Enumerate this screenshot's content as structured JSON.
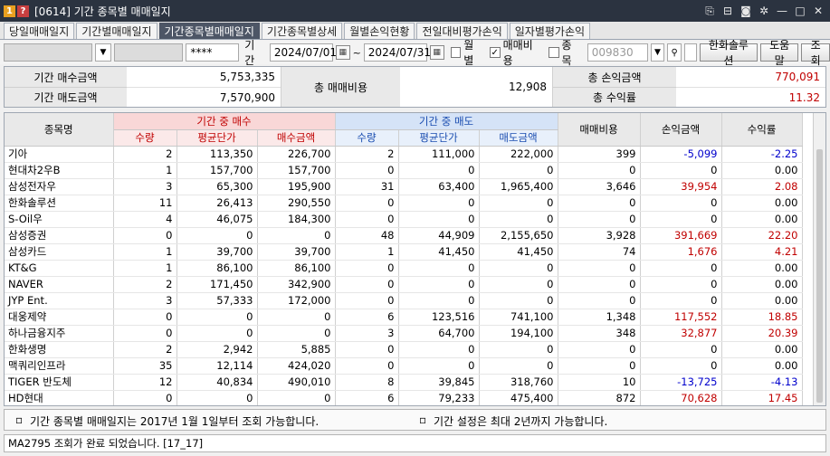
{
  "window": {
    "badge_num": "1",
    "badge_help": "?",
    "title": "[0614] 기간 종목별 매매일지",
    "icons": [
      "link-icon",
      "pin-icon",
      "camera-icon",
      "gear-icon",
      "minimize-icon",
      "maximize-icon",
      "close-icon"
    ]
  },
  "tabs": [
    {
      "label": "당일매매일지",
      "active": false
    },
    {
      "label": "기간별매매일지",
      "active": false
    },
    {
      "label": "기간종목별매매일지",
      "active": true
    },
    {
      "label": "기간종목별상세",
      "active": false
    },
    {
      "label": "월별손익현황",
      "active": false
    },
    {
      "label": "전일대비평가손익",
      "active": false
    },
    {
      "label": "일자별평가손익",
      "active": false
    }
  ],
  "filter": {
    "password": "****",
    "period_label": "기간",
    "start_date": "2024/07/01",
    "tilde": "~",
    "end_date": "2024/07/31",
    "monthly_label": "월별",
    "fee_label": "매매비용",
    "item_label": "종 목",
    "item_placeholder": "009830",
    "company_button": "한화솔루션",
    "help_button": "도움말",
    "query_button": "조회"
  },
  "summary": {
    "buy_amount_label": "기간 매수금액",
    "buy_amount": "5,753,335",
    "sell_amount_label": "기간 매도금액",
    "sell_amount": "7,570,900",
    "total_fee_label": "총 매매비용",
    "total_fee": "12,908",
    "total_pl_label": "총 손익금액",
    "total_pl": "770,091",
    "total_rate_label": "총 수익률",
    "total_rate": "11.32"
  },
  "grid": {
    "headers": {
      "name": "종목명",
      "buy_group": "기간 중 매수",
      "sell_group": "기간 중 매도",
      "fee": "매매비용",
      "pl": "손익금액",
      "rate": "수익률",
      "qty": "수량",
      "avg": "평균단가",
      "buy_amt": "매수금액",
      "sell_amt": "매도금액"
    },
    "rows": [
      [
        "기아",
        "2",
        "113,350",
        "226,700",
        "2",
        "111,000",
        "222,000",
        "399",
        "-5,099",
        "-2.25"
      ],
      [
        "현대차2우B",
        "1",
        "157,700",
        "157,700",
        "0",
        "0",
        "0",
        "0",
        "0",
        "0.00"
      ],
      [
        "삼성전자우",
        "3",
        "65,300",
        "195,900",
        "31",
        "63,400",
        "1,965,400",
        "3,646",
        "39,954",
        "2.08"
      ],
      [
        "한화솔루션",
        "11",
        "26,413",
        "290,550",
        "0",
        "0",
        "0",
        "0",
        "0",
        "0.00"
      ],
      [
        "S-Oil우",
        "4",
        "46,075",
        "184,300",
        "0",
        "0",
        "0",
        "0",
        "0",
        "0.00"
      ],
      [
        "삼성증권",
        "0",
        "0",
        "0",
        "48",
        "44,909",
        "2,155,650",
        "3,928",
        "391,669",
        "22.20"
      ],
      [
        "삼성카드",
        "1",
        "39,700",
        "39,700",
        "1",
        "41,450",
        "41,450",
        "74",
        "1,676",
        "4.21"
      ],
      [
        "KT&G",
        "1",
        "86,100",
        "86,100",
        "0",
        "0",
        "0",
        "0",
        "0",
        "0.00"
      ],
      [
        "NAVER",
        "2",
        "171,450",
        "342,900",
        "0",
        "0",
        "0",
        "0",
        "0",
        "0.00"
      ],
      [
        "JYP Ent.",
        "3",
        "57,333",
        "172,000",
        "0",
        "0",
        "0",
        "0",
        "0",
        "0.00"
      ],
      [
        "대웅제약",
        "0",
        "0",
        "0",
        "6",
        "123,516",
        "741,100",
        "1,348",
        "117,552",
        "18.85"
      ],
      [
        "하나금융지주",
        "0",
        "0",
        "0",
        "3",
        "64,700",
        "194,100",
        "348",
        "32,877",
        "20.39"
      ],
      [
        "한화생명",
        "2",
        "2,942",
        "5,885",
        "0",
        "0",
        "0",
        "0",
        "0",
        "0.00"
      ],
      [
        "맥쿼리인프라",
        "35",
        "12,114",
        "424,020",
        "0",
        "0",
        "0",
        "0",
        "0",
        "0.00"
      ],
      [
        "TIGER 반도체",
        "12",
        "40,834",
        "490,010",
        "8",
        "39,845",
        "318,760",
        "10",
        "-13,725",
        "-4.13"
      ],
      [
        "HD현대",
        "0",
        "0",
        "0",
        "6",
        "79,233",
        "475,400",
        "872",
        "70,628",
        "17.45"
      ]
    ]
  },
  "notes": {
    "left": "기간 종목별 매매일지는 2017년 1월 1일부터 조회 가능합니다.",
    "right": "기간 설정은 최대 2년까지 가능합니다."
  },
  "status": "MA2795 조회가 완료 되었습니다. [17_17]"
}
